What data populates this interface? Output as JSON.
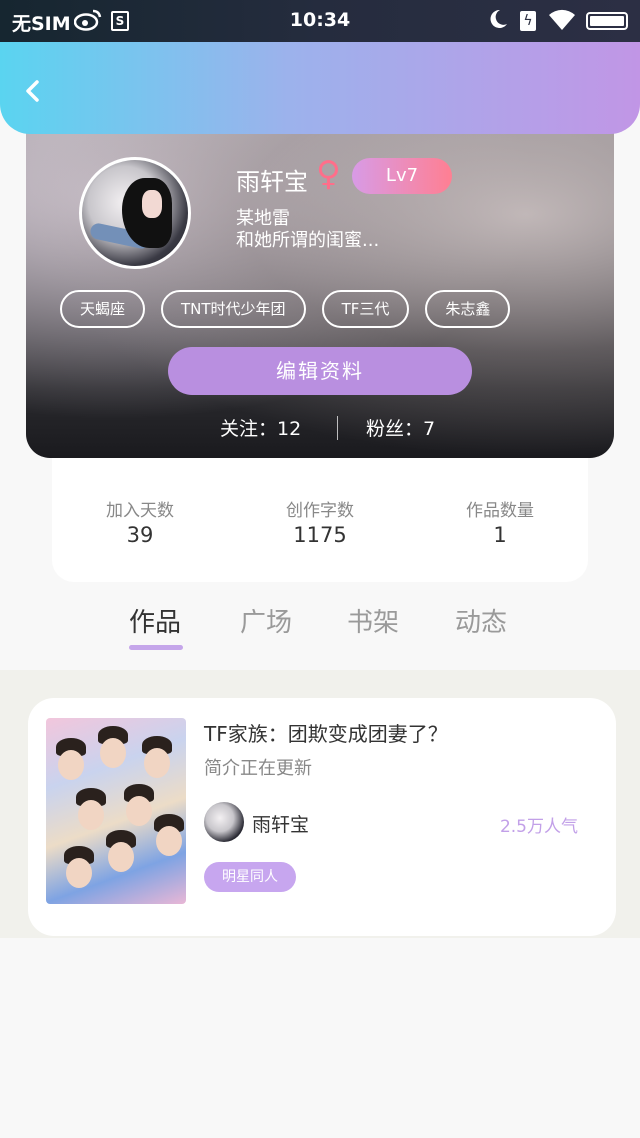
{
  "status_bar": {
    "carrier": "无SIM",
    "s_badge": "S",
    "time": "10:34",
    "charge_glyph": "ϟ"
  },
  "profile": {
    "username": "雨轩宝",
    "gender_symbol": "♀",
    "level": "Lv7",
    "bio_line1": "某地雷",
    "bio_line2": "和她所谓的闺蜜...",
    "tags": [
      "天蝎座",
      "TNT时代少年团",
      "TF三代",
      "朱志鑫"
    ],
    "edit_button": "编辑资料",
    "following": "关注：12",
    "followers": "粉丝：7"
  },
  "stats": [
    {
      "label": "加入天数",
      "value": "39"
    },
    {
      "label": "创作字数",
      "value": "1175"
    },
    {
      "label": "作品数量",
      "value": "1"
    }
  ],
  "tabs": [
    "作品",
    "广场",
    "书架",
    "动态"
  ],
  "active_tab": "作品",
  "work": {
    "title": "TF家族：团欺变成团妻了？",
    "description": "简介正在更新",
    "author": "雨轩宝",
    "popularity": "2.5万人气",
    "tag": "明星同人"
  },
  "colors": {
    "accent": "#b98fe0",
    "topbar_gradient": [
      "#5ad4f0",
      "#c196e6"
    ],
    "tag_purple": "#c7a6ef"
  }
}
